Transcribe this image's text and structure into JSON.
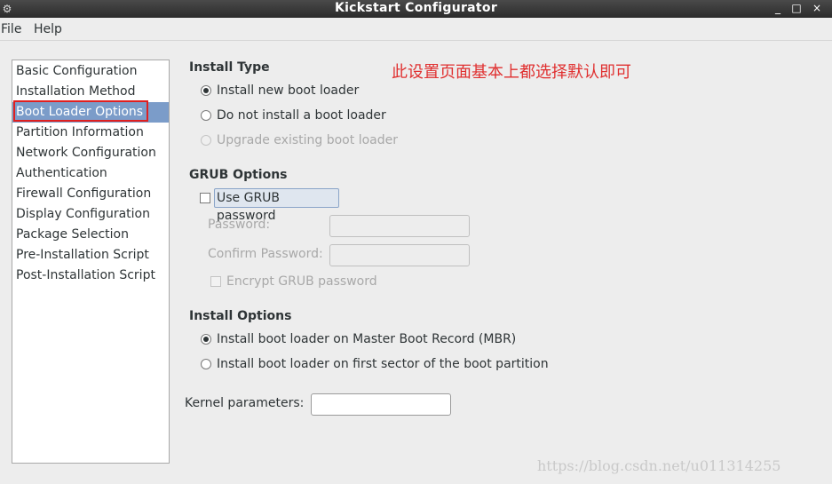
{
  "window": {
    "title": "Kickstart Configurator",
    "minimize_glyph": "_",
    "maximize_glyph": "□",
    "close_glyph": "×"
  },
  "menubar": {
    "file": "File",
    "help": "Help"
  },
  "sidebar": {
    "items": [
      {
        "label": "Basic Configuration"
      },
      {
        "label": "Installation Method"
      },
      {
        "label": "Boot Loader Options"
      },
      {
        "label": "Partition Information"
      },
      {
        "label": "Network Configuration"
      },
      {
        "label": "Authentication"
      },
      {
        "label": "Firewall Configuration"
      },
      {
        "label": "Display Configuration"
      },
      {
        "label": "Package Selection"
      },
      {
        "label": "Pre-Installation Script"
      },
      {
        "label": "Post-Installation Script"
      }
    ],
    "selected_index": 2
  },
  "annotation": "此设置页面基本上都选择默认即可",
  "install_type": {
    "title": "Install Type",
    "options": [
      {
        "label": "Install new boot loader",
        "checked": true,
        "enabled": true
      },
      {
        "label": "Do not install a boot loader",
        "checked": false,
        "enabled": true
      },
      {
        "label": "Upgrade existing boot loader",
        "checked": false,
        "enabled": false
      }
    ]
  },
  "grub_options": {
    "title": "GRUB Options",
    "use_password_label": "Use GRUB password",
    "use_password_checked": false,
    "password_label": "Password:",
    "confirm_password_label": "Confirm Password:",
    "encrypt_label": "Encrypt GRUB password",
    "encrypt_checked": false
  },
  "install_options": {
    "title": "Install Options",
    "options": [
      {
        "label": "Install boot loader on Master Boot Record (MBR)",
        "checked": true
      },
      {
        "label": "Install boot loader on first sector of the boot partition",
        "checked": false
      }
    ]
  },
  "kernel": {
    "label": "Kernel parameters:",
    "value": ""
  },
  "watermark": "https://blog.csdn.net/u011314255"
}
